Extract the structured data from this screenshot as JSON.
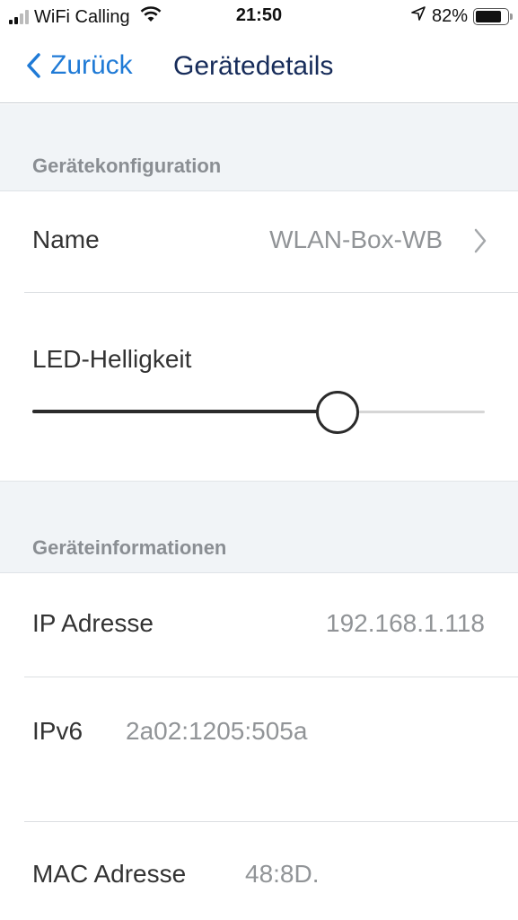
{
  "status_bar": {
    "carrier": "WiFi Calling",
    "time": "21:50",
    "battery": "82%",
    "battery_fraction": 0.82,
    "signal_bars_active": 2,
    "signal_bars_total": 4,
    "icons": [
      "signal-icon",
      "wifi-icon",
      "location-arrow-icon",
      "battery-icon"
    ]
  },
  "nav": {
    "back_label": "Zurück",
    "title": "Gerätedetails",
    "accent_color": "#1f7ad6",
    "title_color": "#172c5a"
  },
  "sections": {
    "config": {
      "header": "Gerätekonfiguration",
      "name_row": {
        "key": "Name",
        "value": "WLAN-Box-WB"
      },
      "led_row": {
        "key": "LED-Helligkeit",
        "slider_value": 0.675
      }
    },
    "info": {
      "header": "Geräteinformationen",
      "ip_row": {
        "key": "IP Adresse",
        "value": "192.168.1.118"
      },
      "ipv6_row": {
        "key": "IPv6",
        "value": "2a02:1205:505a"
      },
      "mac_row": {
        "key": "MAC Adresse",
        "value": "48:8D."
      }
    }
  }
}
